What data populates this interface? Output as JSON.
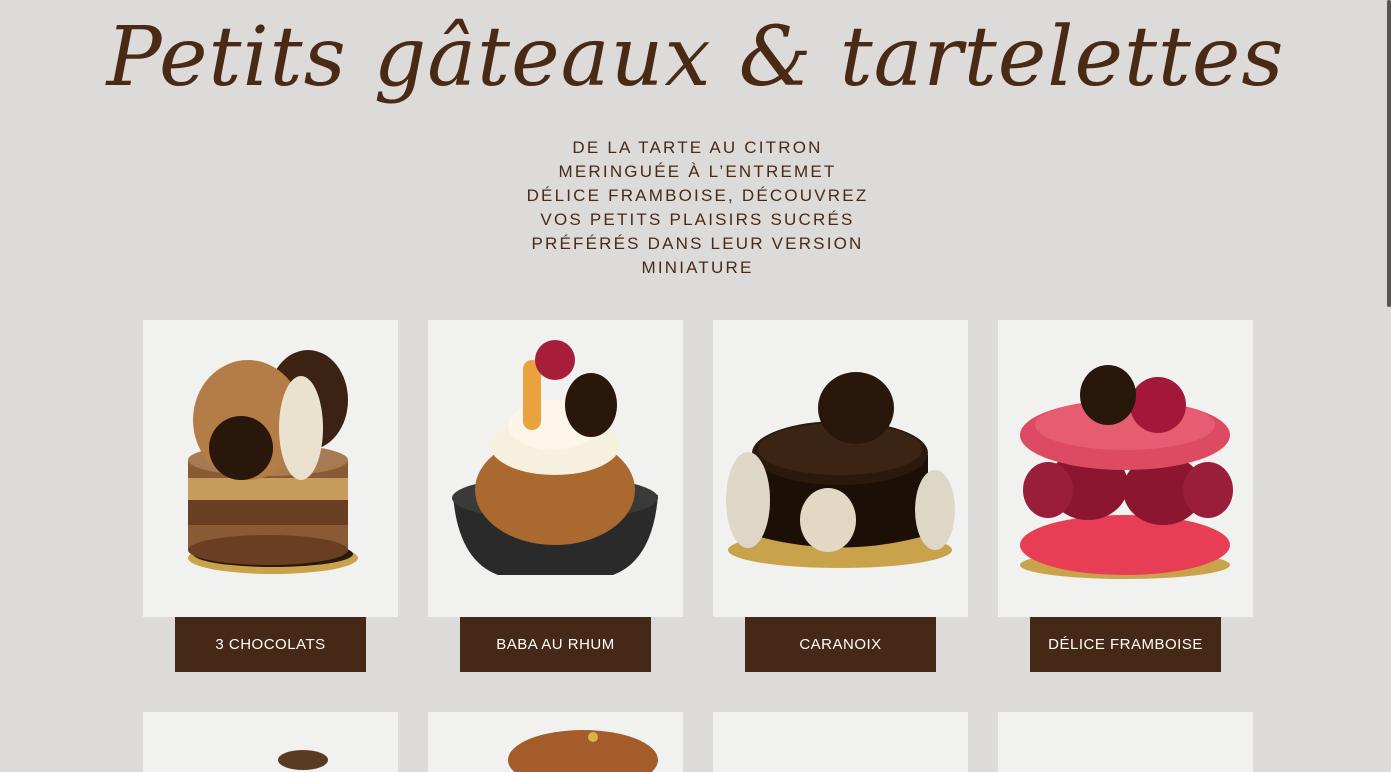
{
  "page": {
    "title": "Petits gâteaux & tartelettes",
    "subtitle_lines": [
      "De la tarte au citron",
      "meringuée à l’entremet",
      "Délice framboise, découvrez",
      "vos petits plaisirs sucrés",
      "préférés dans leur version",
      "miniature"
    ]
  },
  "products": [
    {
      "name": "3 CHOCOLATS",
      "image": "three-chocolate-cake"
    },
    {
      "name": "BABA AU RHUM",
      "image": "rum-baba"
    },
    {
      "name": "CARANOIX",
      "image": "caranoix-cake"
    },
    {
      "name": "DÉLICE FRAMBOISE",
      "image": "raspberry-macaron"
    }
  ],
  "colors": {
    "background": "#dcdbda",
    "brand_brown": "#462816",
    "title_brown": "#4a2a14"
  }
}
